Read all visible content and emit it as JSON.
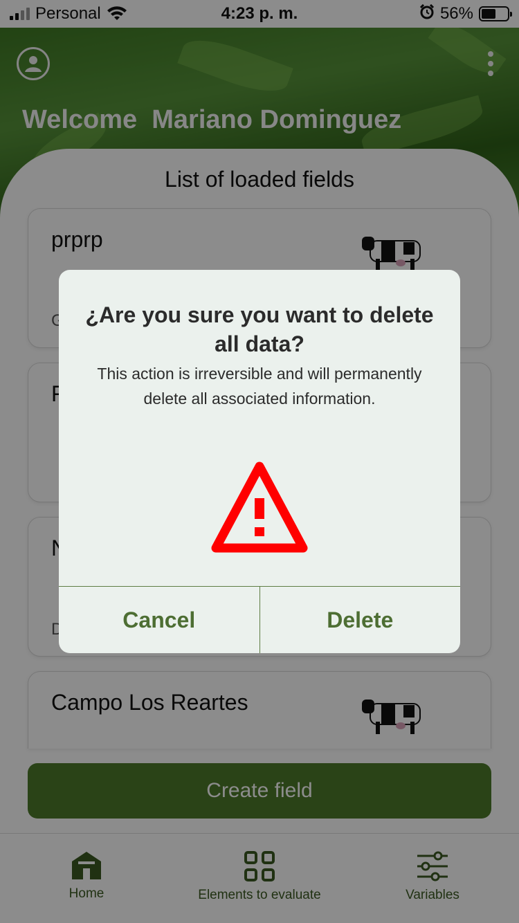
{
  "status_bar": {
    "carrier": "Personal",
    "time": "4:23 p. m.",
    "battery_percent": "56%",
    "battery_level": 0.56
  },
  "header": {
    "welcome_text": "Welcome  Mariano Dominguez",
    "profile_icon": "account-circle-icon",
    "menu_icon": "more-vertical-icon"
  },
  "main": {
    "list_title": "List of loaded fields",
    "cards": [
      {
        "name": "prprp",
        "sub": "G",
        "icon": "cow-icon"
      },
      {
        "name": "F",
        "sub": "",
        "icon": "cow-icon"
      },
      {
        "name": "N",
        "sub": "D",
        "icon": "cow-icon"
      },
      {
        "name": "Campo Los Reartes",
        "sub": "",
        "icon": "cow-icon"
      }
    ],
    "create_button": "Create field"
  },
  "tabbar": {
    "items": [
      {
        "label": "Home",
        "icon": "barn-icon"
      },
      {
        "label": "Elements to evaluate",
        "icon": "grid-icon"
      },
      {
        "label": "Variables",
        "icon": "sliders-icon"
      }
    ]
  },
  "dialog": {
    "title": "¿Are you sure you want to delete all data?",
    "message": "This action is irreversible and will permanently delete all associated information.",
    "icon": "warning-icon",
    "cancel_label": "Cancel",
    "delete_label": "Delete"
  },
  "colors": {
    "accent": "#4d6e33",
    "warning": "#ff0000",
    "dialog_bg": "#ebf1ed"
  }
}
